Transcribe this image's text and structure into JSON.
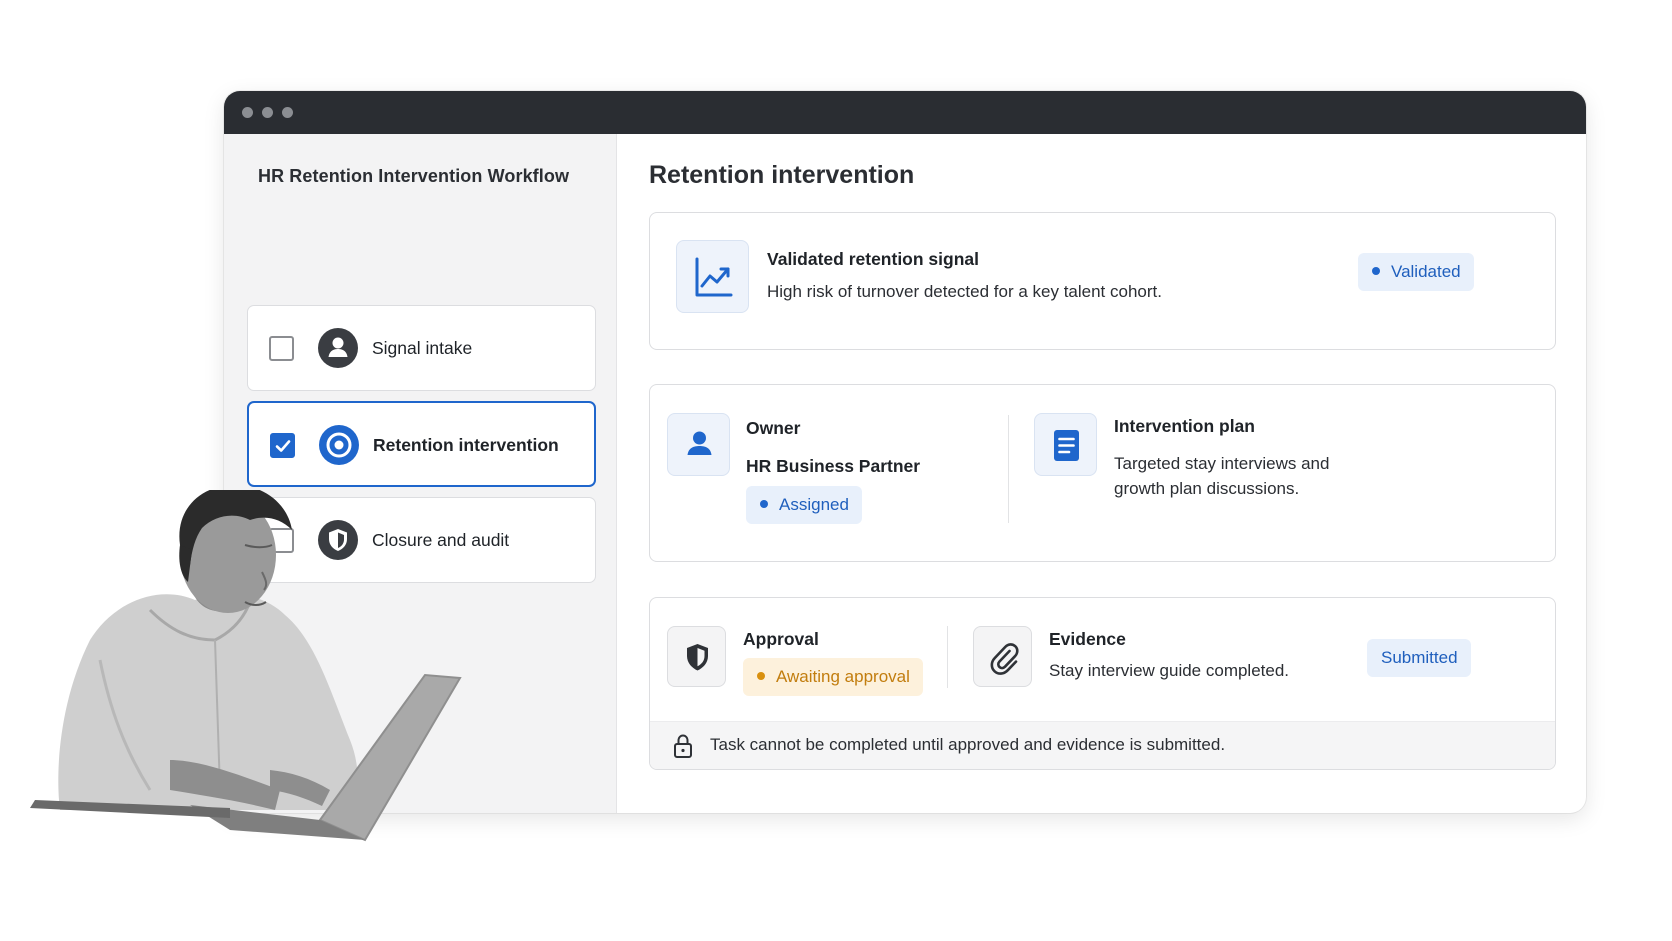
{
  "colors": {
    "accent": "#1f66cc",
    "titlebar": "#2a2d32",
    "sidebar_bg": "#f3f3f4",
    "badge_blue_bg": "#e8f0fb",
    "badge_amber_bg": "#fdf1dc",
    "badge_amber_text": "#c27d0e"
  },
  "sidebar": {
    "title": "HR Retention Intervention Workflow",
    "steps": [
      {
        "label": "Signal intake",
        "icon": "person-icon",
        "checked": false,
        "active": false
      },
      {
        "label": "Retention intervention",
        "icon": "target-icon",
        "checked": true,
        "active": true
      },
      {
        "label": "Closure and audit",
        "icon": "shield-icon",
        "checked": false,
        "active": false
      }
    ]
  },
  "main": {
    "title": "Retention intervention",
    "signal": {
      "icon": "trend-chart-icon",
      "heading": "Validated retention signal",
      "description": "High risk of turnover detected for a key talent cohort.",
      "status": "Validated"
    },
    "owner": {
      "icon": "person-icon",
      "heading": "Owner",
      "name": "HR Business Partner",
      "status": "Assigned"
    },
    "plan": {
      "icon": "document-icon",
      "heading": "Intervention plan",
      "description": "Targeted stay interviews and growth plan discussions."
    },
    "approval": {
      "icon": "shield-icon",
      "heading": "Approval",
      "status": "Awaiting approval"
    },
    "evidence": {
      "icon": "paperclip-icon",
      "heading": "Evidence",
      "description": "Stay interview guide completed.",
      "status": "Submitted"
    },
    "footer_note": "Task cannot be completed until approved and evidence is submitted."
  }
}
